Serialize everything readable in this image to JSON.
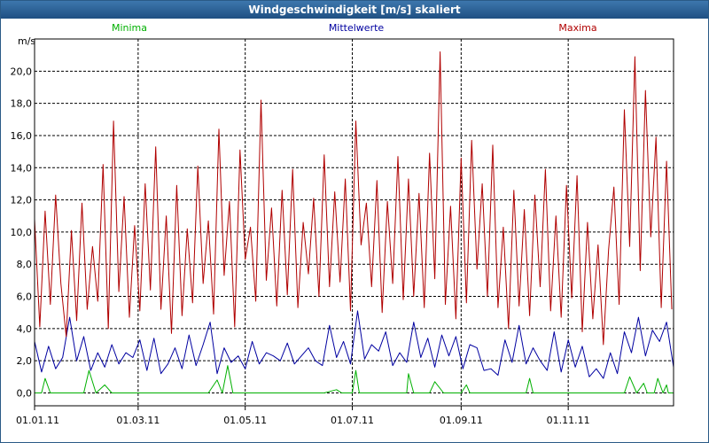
{
  "window": {
    "title": "Windgeschwindigkeit [m/s] skaliert"
  },
  "colors": {
    "minima": "#00b000",
    "mittel": "#0000a0",
    "maxima": "#b00000",
    "grid": "#000000",
    "titlebar": "#1f4f82"
  },
  "chart_data": {
    "type": "line",
    "title": "Windgeschwindigkeit [m/s] skaliert",
    "ylabel": "m/s",
    "xlabel": "",
    "ylim": [
      -0.8,
      22.0
    ],
    "xlim": [
      "2011-01-01",
      "2011-12-31"
    ],
    "y_ticks": [
      "0,0",
      "2,0",
      "4,0",
      "6,0",
      "8,0",
      "10,0",
      "12,0",
      "14,0",
      "16,0",
      "18,0",
      "20,0"
    ],
    "y_tick_values": [
      0,
      2,
      4,
      6,
      8,
      10,
      12,
      14,
      16,
      18,
      20
    ],
    "x_ticks": [
      "01.01.11",
      "01.03.11",
      "01.05.11",
      "01.07.11",
      "01.09.11",
      "01.11.11"
    ],
    "x_tick_dates": [
      "2011-01-01",
      "2011-03-01",
      "2011-05-01",
      "2011-07-01",
      "2011-09-01",
      "2011-11-01"
    ],
    "grid": true,
    "legend_position": "top",
    "series": [
      {
        "name": "Minima",
        "color": "#00b000",
        "x": [
          "2011-01-01",
          "2011-01-05",
          "2011-01-07",
          "2011-01-10",
          "2011-01-20",
          "2011-01-26",
          "2011-01-29",
          "2011-02-01",
          "2011-02-05",
          "2011-02-10",
          "2011-02-14",
          "2011-02-20",
          "2011-03-01",
          "2011-03-10",
          "2011-03-25",
          "2011-04-01",
          "2011-04-10",
          "2011-04-15",
          "2011-04-18",
          "2011-04-21",
          "2011-04-24",
          "2011-05-01",
          "2011-05-20",
          "2011-06-01",
          "2011-06-15",
          "2011-06-22",
          "2011-06-25",
          "2011-06-28",
          "2011-07-01",
          "2011-07-03",
          "2011-07-05",
          "2011-07-12",
          "2011-07-20",
          "2011-08-01",
          "2011-08-02",
          "2011-08-05",
          "2011-08-14",
          "2011-08-17",
          "2011-08-22",
          "2011-08-25",
          "2011-08-28",
          "2011-09-01",
          "2011-09-04",
          "2011-09-06",
          "2011-09-15",
          "2011-10-01",
          "2011-10-08",
          "2011-10-10",
          "2011-10-12",
          "2011-10-16",
          "2011-10-20",
          "2011-10-28",
          "2011-11-01",
          "2011-11-10",
          "2011-11-20",
          "2011-11-28",
          "2011-12-03",
          "2011-12-06",
          "2011-12-10",
          "2011-12-14",
          "2011-12-16",
          "2011-12-20",
          "2011-12-22",
          "2011-12-25",
          "2011-12-27",
          "2011-12-28",
          "2011-12-31"
        ],
        "y": [
          0.0,
          0.0,
          0.9,
          0.0,
          0.0,
          0.0,
          0.0,
          1.4,
          0.0,
          0.5,
          0.0,
          0.0,
          0.0,
          0.0,
          0.0,
          0.0,
          0.0,
          0.8,
          0.0,
          1.7,
          0.0,
          0.0,
          0.0,
          0.0,
          0.0,
          0.2,
          0.0,
          0.0,
          0.0,
          1.4,
          0.0,
          0.0,
          0.0,
          0.0,
          1.2,
          0.0,
          0.0,
          0.7,
          0.0,
          0.0,
          0.0,
          0.0,
          0.5,
          0.0,
          0.0,
          0.0,
          0.0,
          0.9,
          0.0,
          0.0,
          0.0,
          0.0,
          0.0,
          0.0,
          0.0,
          0.0,
          0.0,
          1.0,
          0.0,
          0.6,
          0.0,
          0.0,
          0.9,
          0.0,
          0.5,
          0.0,
          0.0
        ]
      },
      {
        "name": "Mittelwerte",
        "color": "#0000a0",
        "x": [
          "2011-01-01",
          "2011-01-05",
          "2011-01-09",
          "2011-01-13",
          "2011-01-17",
          "2011-01-21",
          "2011-01-25",
          "2011-01-29",
          "2011-02-02",
          "2011-02-06",
          "2011-02-10",
          "2011-02-14",
          "2011-02-18",
          "2011-02-22",
          "2011-02-26",
          "2011-03-02",
          "2011-03-06",
          "2011-03-10",
          "2011-03-14",
          "2011-03-18",
          "2011-03-22",
          "2011-03-26",
          "2011-03-30",
          "2011-04-03",
          "2011-04-07",
          "2011-04-11",
          "2011-04-15",
          "2011-04-19",
          "2011-04-23",
          "2011-04-27",
          "2011-05-01",
          "2011-05-05",
          "2011-05-09",
          "2011-05-13",
          "2011-05-17",
          "2011-05-21",
          "2011-05-25",
          "2011-05-29",
          "2011-06-02",
          "2011-06-06",
          "2011-06-10",
          "2011-06-14",
          "2011-06-18",
          "2011-06-22",
          "2011-06-26",
          "2011-06-30",
          "2011-07-04",
          "2011-07-08",
          "2011-07-12",
          "2011-07-16",
          "2011-07-20",
          "2011-07-24",
          "2011-07-28",
          "2011-08-01",
          "2011-08-05",
          "2011-08-09",
          "2011-08-13",
          "2011-08-17",
          "2011-08-21",
          "2011-08-25",
          "2011-08-29",
          "2011-09-02",
          "2011-09-06",
          "2011-09-10",
          "2011-09-14",
          "2011-09-18",
          "2011-09-22",
          "2011-09-26",
          "2011-09-30",
          "2011-10-04",
          "2011-10-08",
          "2011-10-12",
          "2011-10-16",
          "2011-10-20",
          "2011-10-24",
          "2011-10-28",
          "2011-11-01",
          "2011-11-05",
          "2011-11-09",
          "2011-11-13",
          "2011-11-17",
          "2011-11-21",
          "2011-11-25",
          "2011-11-29",
          "2011-12-03",
          "2011-12-07",
          "2011-12-11",
          "2011-12-15",
          "2011-12-19",
          "2011-12-23",
          "2011-12-27",
          "2011-12-31"
        ],
        "y": [
          3.2,
          1.3,
          2.9,
          1.5,
          2.2,
          4.7,
          2.0,
          3.5,
          1.4,
          2.5,
          1.6,
          3.0,
          1.8,
          2.5,
          2.2,
          3.3,
          1.4,
          3.4,
          1.2,
          1.8,
          2.8,
          1.5,
          3.6,
          1.7,
          3.0,
          4.4,
          1.2,
          2.8,
          1.9,
          2.3,
          1.5,
          3.2,
          1.8,
          2.5,
          2.3,
          2.0,
          3.1,
          1.8,
          2.3,
          2.8,
          2.0,
          1.7,
          4.2,
          2.2,
          3.2,
          1.8,
          5.1,
          2.1,
          3.0,
          2.6,
          3.8,
          1.7,
          2.5,
          1.9,
          4.4,
          2.2,
          3.4,
          1.6,
          3.6,
          2.3,
          3.5,
          1.5,
          3.0,
          2.8,
          1.4,
          1.5,
          1.1,
          3.3,
          1.9,
          4.2,
          1.8,
          2.8,
          2.0,
          1.4,
          3.8,
          1.3,
          3.3,
          1.6,
          2.9,
          1.0,
          1.5,
          0.9,
          2.5,
          1.2,
          3.8,
          2.5,
          4.7,
          2.3,
          3.9,
          3.2,
          4.4,
          1.6
        ]
      },
      {
        "name": "Maxima",
        "color": "#b00000",
        "x": [
          "2011-01-01",
          "2011-01-04",
          "2011-01-07",
          "2011-01-10",
          "2011-01-13",
          "2011-01-16",
          "2011-01-19",
          "2011-01-22",
          "2011-01-25",
          "2011-01-28",
          "2011-01-31",
          "2011-02-03",
          "2011-02-06",
          "2011-02-09",
          "2011-02-12",
          "2011-02-15",
          "2011-02-18",
          "2011-02-21",
          "2011-02-24",
          "2011-02-27",
          "2011-03-02",
          "2011-03-05",
          "2011-03-08",
          "2011-03-11",
          "2011-03-14",
          "2011-03-17",
          "2011-03-20",
          "2011-03-23",
          "2011-03-26",
          "2011-03-29",
          "2011-04-01",
          "2011-04-04",
          "2011-04-07",
          "2011-04-10",
          "2011-04-13",
          "2011-04-16",
          "2011-04-19",
          "2011-04-22",
          "2011-04-25",
          "2011-04-28",
          "2011-05-01",
          "2011-05-04",
          "2011-05-07",
          "2011-05-10",
          "2011-05-13",
          "2011-05-16",
          "2011-05-19",
          "2011-05-22",
          "2011-05-25",
          "2011-05-28",
          "2011-05-31",
          "2011-06-03",
          "2011-06-06",
          "2011-06-09",
          "2011-06-12",
          "2011-06-15",
          "2011-06-18",
          "2011-06-21",
          "2011-06-24",
          "2011-06-27",
          "2011-06-30",
          "2011-07-03",
          "2011-07-06",
          "2011-07-09",
          "2011-07-12",
          "2011-07-15",
          "2011-07-18",
          "2011-07-21",
          "2011-07-24",
          "2011-07-27",
          "2011-07-30",
          "2011-08-02",
          "2011-08-05",
          "2011-08-08",
          "2011-08-11",
          "2011-08-14",
          "2011-08-17",
          "2011-08-20",
          "2011-08-23",
          "2011-08-26",
          "2011-08-29",
          "2011-09-01",
          "2011-09-04",
          "2011-09-07",
          "2011-09-10",
          "2011-09-13",
          "2011-09-16",
          "2011-09-19",
          "2011-09-22",
          "2011-09-25",
          "2011-09-28",
          "2011-10-01",
          "2011-10-04",
          "2011-10-07",
          "2011-10-10",
          "2011-10-13",
          "2011-10-16",
          "2011-10-19",
          "2011-10-22",
          "2011-10-25",
          "2011-10-28",
          "2011-10-31",
          "2011-11-03",
          "2011-11-06",
          "2011-11-09",
          "2011-11-12",
          "2011-11-15",
          "2011-11-18",
          "2011-11-21",
          "2011-11-24",
          "2011-11-27",
          "2011-11-30",
          "2011-12-03",
          "2011-12-06",
          "2011-12-09",
          "2011-12-12",
          "2011-12-15",
          "2011-12-18",
          "2011-12-21",
          "2011-12-24",
          "2011-12-27",
          "2011-12-30"
        ],
        "y": [
          10.8,
          4.1,
          11.3,
          5.5,
          12.3,
          6.8,
          3.5,
          10.1,
          4.5,
          11.8,
          5.2,
          9.1,
          5.7,
          14.2,
          4.0,
          16.9,
          6.3,
          12.2,
          4.7,
          10.4,
          5.1,
          13.0,
          6.4,
          15.3,
          5.2,
          11.0,
          3.7,
          12.9,
          4.8,
          10.2,
          5.6,
          14.1,
          6.8,
          10.7,
          4.9,
          16.4,
          7.3,
          11.9,
          4.1,
          15.1,
          8.3,
          10.3,
          5.7,
          18.2,
          7.0,
          11.5,
          5.4,
          12.6,
          6.1,
          13.9,
          5.3,
          10.6,
          7.4,
          12.1,
          6.0,
          14.8,
          6.6,
          12.5,
          6.9,
          13.3,
          5.1,
          16.9,
          9.2,
          11.8,
          6.6,
          13.2,
          5.0,
          11.9,
          6.8,
          14.7,
          5.8,
          13.3,
          6.0,
          12.4,
          5.3,
          14.9,
          7.1,
          21.2,
          5.5,
          11.6,
          4.6,
          14.6,
          5.6,
          15.7,
          7.7,
          13.0,
          6.0,
          15.4,
          5.3,
          10.3,
          4.0,
          12.6,
          5.4,
          11.4,
          4.8,
          12.3,
          6.6,
          13.9,
          5.1,
          11.0,
          4.7,
          12.9,
          5.9,
          13.5,
          3.8,
          10.6,
          4.6,
          9.2,
          3.0,
          8.9,
          12.8,
          5.5,
          17.6,
          9.1,
          20.9,
          7.6,
          18.8,
          9.7,
          15.9,
          5.3,
          14.4,
          5.2
        ]
      }
    ]
  }
}
